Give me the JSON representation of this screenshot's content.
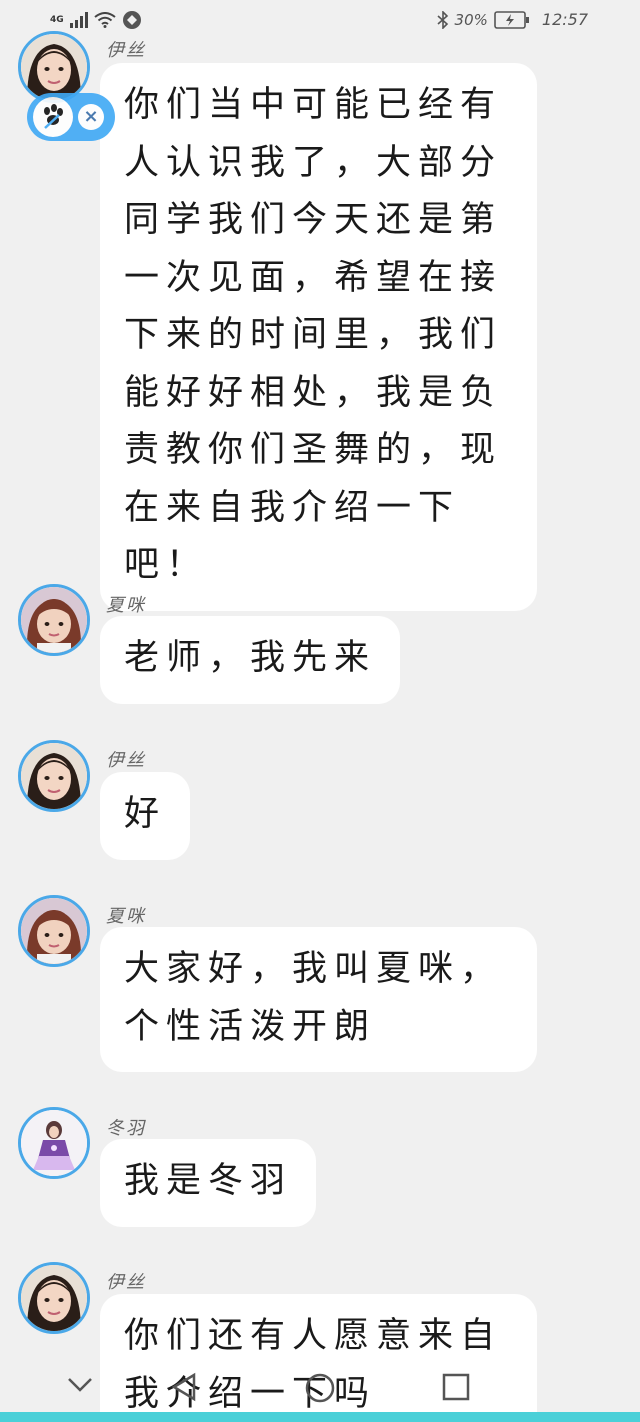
{
  "status_bar": {
    "network_type": "4G",
    "battery_percent": "30%",
    "time": "12:57",
    "icons": [
      "signal-icon",
      "wifi-icon",
      "vpn-icon",
      "bluetooth-icon",
      "battery-icon"
    ]
  },
  "messages": [
    {
      "sender": "伊丝",
      "text": "你们当中可能已经有人认识我了，大部分同学我们今天还是第一次见面，希望在接下来的时间里，我们能好好相处，我是负责教你们圣舞的，现在来自我介绍一下吧！"
    },
    {
      "sender": "夏咪",
      "text": "老师，我先来"
    },
    {
      "sender": "伊丝",
      "text": "好"
    },
    {
      "sender": "夏咪",
      "text": "大家好，我叫夏咪，个性活泼开朗"
    },
    {
      "sender": "冬羽",
      "text": "我是冬羽"
    },
    {
      "sender": "伊丝",
      "text": "你们还有人愿意来自我介绍一下吗"
    }
  ],
  "floating_widget": {
    "icon": "paw-icon",
    "close_label": "×"
  },
  "nav_bar": {
    "icons": [
      "chevron-down-icon",
      "back-triangle-icon",
      "home-circle-icon",
      "recents-square-icon"
    ]
  },
  "colors": {
    "avatar_ring": "#4aa8e8",
    "pill": "#3fa9f5",
    "background": "#f0f0f0",
    "bubble": "#ffffff",
    "bottom_strip": "#4ad0d8"
  }
}
